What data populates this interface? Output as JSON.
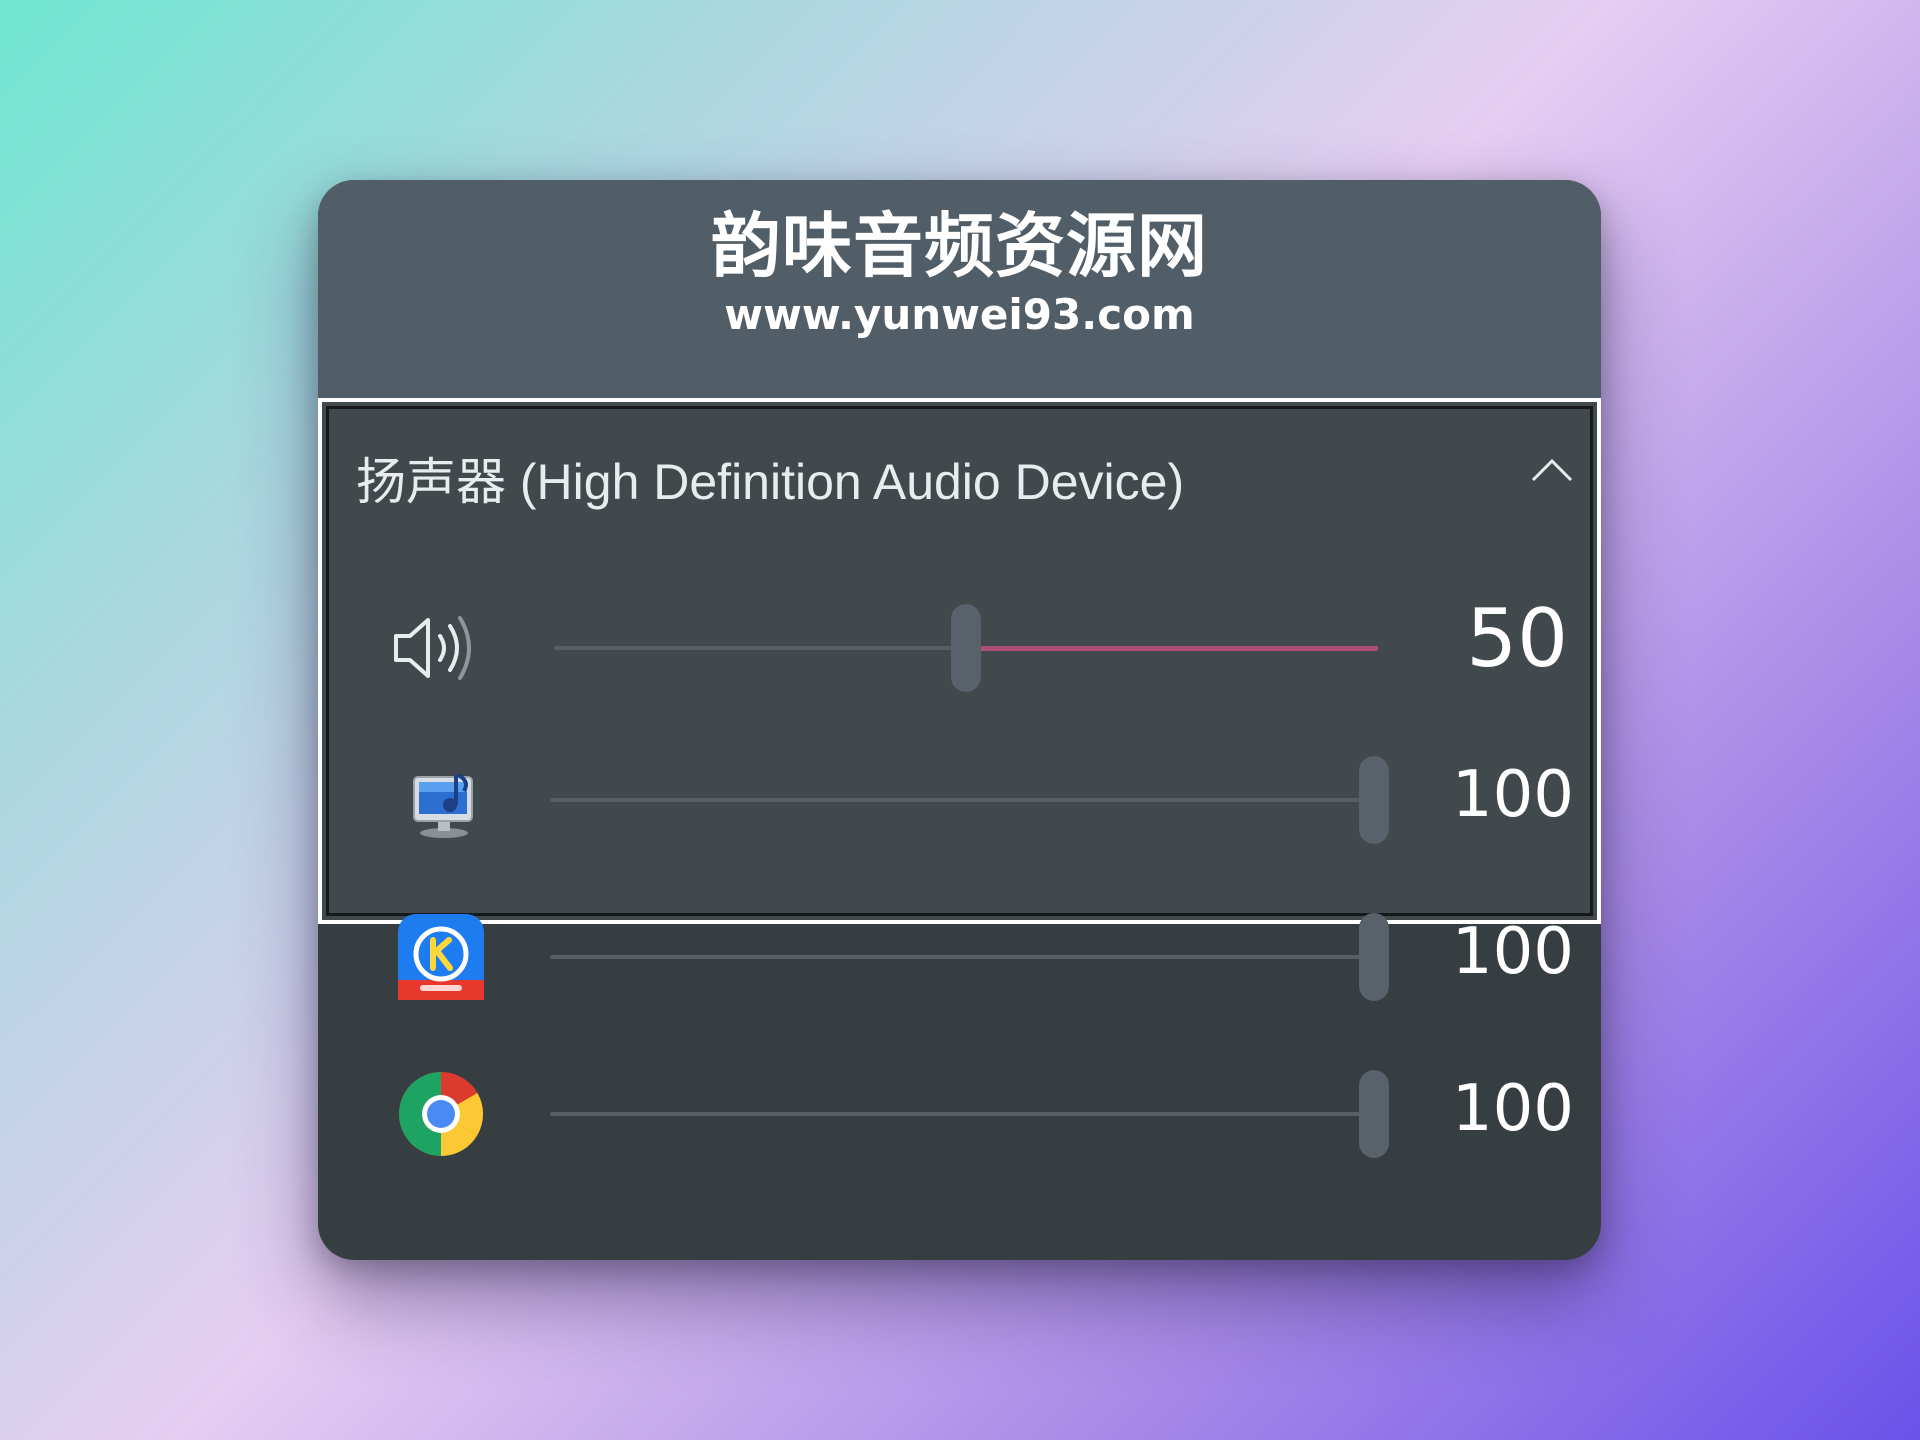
{
  "header": {
    "title": "韵味音频资源网",
    "url": "www.yunwei93.com"
  },
  "device": {
    "name": "扬声器 (High Definition Audio Device)",
    "volume": 50,
    "volume_label": "50",
    "accent_color": "#ad4d78"
  },
  "apps": [
    {
      "icon": "system-sounds-icon",
      "volume": 100,
      "volume_label": "100"
    },
    {
      "icon": "kugou-music-icon",
      "volume": 100,
      "volume_label": "100"
    },
    {
      "icon": "chrome-icon",
      "volume": 100,
      "volume_label": "100"
    }
  ],
  "colors": {
    "panel": "#373e42",
    "header": "#525e67",
    "device_panel": "#42494d"
  }
}
